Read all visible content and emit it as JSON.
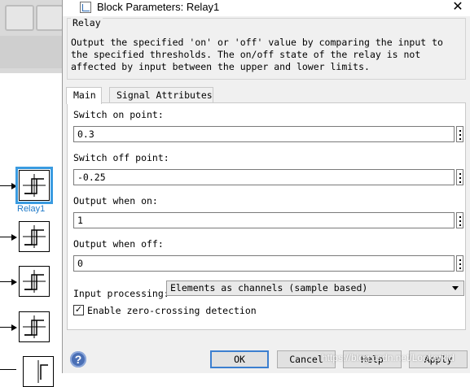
{
  "dialog": {
    "title": "Block Parameters: Relay1",
    "group_title": "Relay",
    "description": "Output the specified 'on' or 'off' value by comparing the input to the specified thresholds.  The on/off state of the relay is not affected by input between the upper and lower limits.",
    "tabs": [
      {
        "label": "Main",
        "active": true
      },
      {
        "label": "Signal Attributes",
        "active": false
      }
    ],
    "fields": {
      "switch_on": {
        "label": "Switch on point:",
        "value": "0.3"
      },
      "switch_off": {
        "label": "Switch off point:",
        "value": "-0.25"
      },
      "output_on": {
        "label": "Output when on:",
        "value": "1"
      },
      "output_off": {
        "label": "Output when off:",
        "value": "0"
      }
    },
    "input_processing": {
      "label": "Input processing:",
      "selected": "Elements as channels (sample based)"
    },
    "zero_crossing": {
      "label": "Enable zero-crossing detection",
      "checked": true
    },
    "buttons": {
      "ok": "OK",
      "cancel": "Cancel",
      "help": "Help",
      "apply": "Apply"
    },
    "help_glyph": "?",
    "close_glyph": "✕"
  },
  "canvas": {
    "selected_block_label": "Relay1",
    "block_count": 5,
    "selection_color": "#3a9be0"
  },
  "watermark": "https://blog.csdn.net/Lookerkid"
}
